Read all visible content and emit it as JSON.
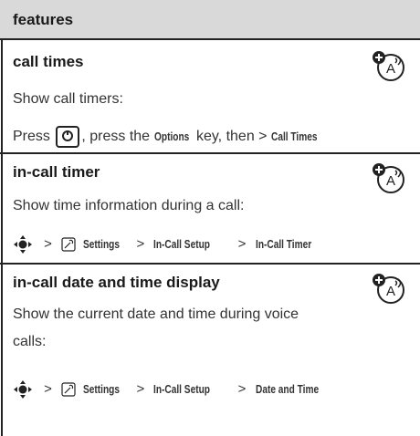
{
  "header": {
    "title": "features"
  },
  "sections": [
    {
      "title": "call times",
      "desc": "Show call timers:",
      "press_prefix": "Press",
      "press_mid": ", press the",
      "options_key": "Options",
      "press_suffix": "key, then >",
      "press_cmd": "Call Times"
    },
    {
      "title": "in-call timer",
      "desc": "Show time information during a call:",
      "path": [
        "Settings",
        "In-Call Setup",
        "In-Call Timer"
      ]
    },
    {
      "title": "in-call date and time display",
      "desc": "Show the current date and time during voice calls:",
      "path": [
        "Settings",
        "In-Call Setup",
        "Date and Time"
      ]
    }
  ],
  "separator": ">"
}
